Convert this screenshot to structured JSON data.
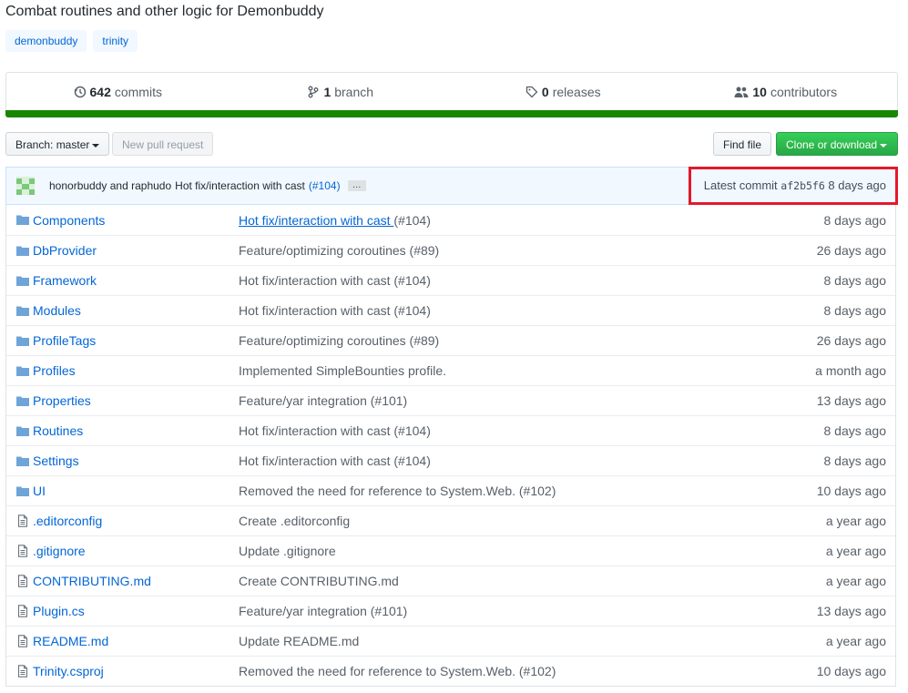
{
  "repo": {
    "description": "Combat routines and other logic for Demonbuddy",
    "topics": [
      "demonbuddy",
      "trinity"
    ]
  },
  "stats": {
    "commits": {
      "count": "642",
      "label": "commits"
    },
    "branches": {
      "count": "1",
      "label": "branch"
    },
    "releases": {
      "count": "0",
      "label": "releases"
    },
    "contributors": {
      "count": "10",
      "label": "contributors"
    }
  },
  "colors": {
    "language_bar": "#178600",
    "link": "#0366d6",
    "highlight_box": "#e3192a"
  },
  "toolbar": {
    "branch_label": "Branch: master",
    "new_pr_label": "New pull request",
    "find_file_label": "Find file",
    "clone_label": "Clone or download"
  },
  "commit": {
    "author1": "honorbuddy",
    "and": "and",
    "author2": "raphudo",
    "message": "Hot fix/interaction with cast",
    "pr": "(#104)",
    "ellipsis": "…",
    "latest_label": "Latest commit",
    "sha": "af2b5f6",
    "age": "8 days ago"
  },
  "files": [
    {
      "type": "dir",
      "name": "Components",
      "msg_link": "Hot fix/interaction with cast ",
      "msg_rest": "(#104)",
      "age": "8 days ago"
    },
    {
      "type": "dir",
      "name": "DbProvider",
      "msg": "Feature/optimizing coroutines (#89)",
      "age": "26 days ago"
    },
    {
      "type": "dir",
      "name": "Framework",
      "msg": "Hot fix/interaction with cast (#104)",
      "age": "8 days ago"
    },
    {
      "type": "dir",
      "name": "Modules",
      "msg": "Hot fix/interaction with cast (#104)",
      "age": "8 days ago"
    },
    {
      "type": "dir",
      "name": "ProfileTags",
      "msg": "Feature/optimizing coroutines (#89)",
      "age": "26 days ago"
    },
    {
      "type": "dir",
      "name": "Profiles",
      "msg": "Implemented SimpleBounties profile.",
      "age": "a month ago"
    },
    {
      "type": "dir",
      "name": "Properties",
      "msg": "Feature/yar integration (#101)",
      "age": "13 days ago"
    },
    {
      "type": "dir",
      "name": "Routines",
      "msg": "Hot fix/interaction with cast (#104)",
      "age": "8 days ago"
    },
    {
      "type": "dir",
      "name": "Settings",
      "msg": "Hot fix/interaction with cast (#104)",
      "age": "8 days ago"
    },
    {
      "type": "dir",
      "name": "UI",
      "msg": "Removed the need for reference to System.Web. (#102)",
      "age": "10 days ago"
    },
    {
      "type": "file",
      "name": ".editorconfig",
      "msg": "Create .editorconfig",
      "age": "a year ago"
    },
    {
      "type": "file",
      "name": ".gitignore",
      "msg": "Update .gitignore",
      "age": "a year ago"
    },
    {
      "type": "file",
      "name": "CONTRIBUTING.md",
      "msg": "Create CONTRIBUTING.md",
      "age": "a year ago"
    },
    {
      "type": "file",
      "name": "Plugin.cs",
      "msg": "Feature/yar integration (#101)",
      "age": "13 days ago"
    },
    {
      "type": "file",
      "name": "README.md",
      "msg": "Update README.md",
      "age": "a year ago"
    },
    {
      "type": "file",
      "name": "Trinity.csproj",
      "msg": "Removed the need for reference to System.Web. (#102)",
      "age": "10 days ago"
    }
  ]
}
